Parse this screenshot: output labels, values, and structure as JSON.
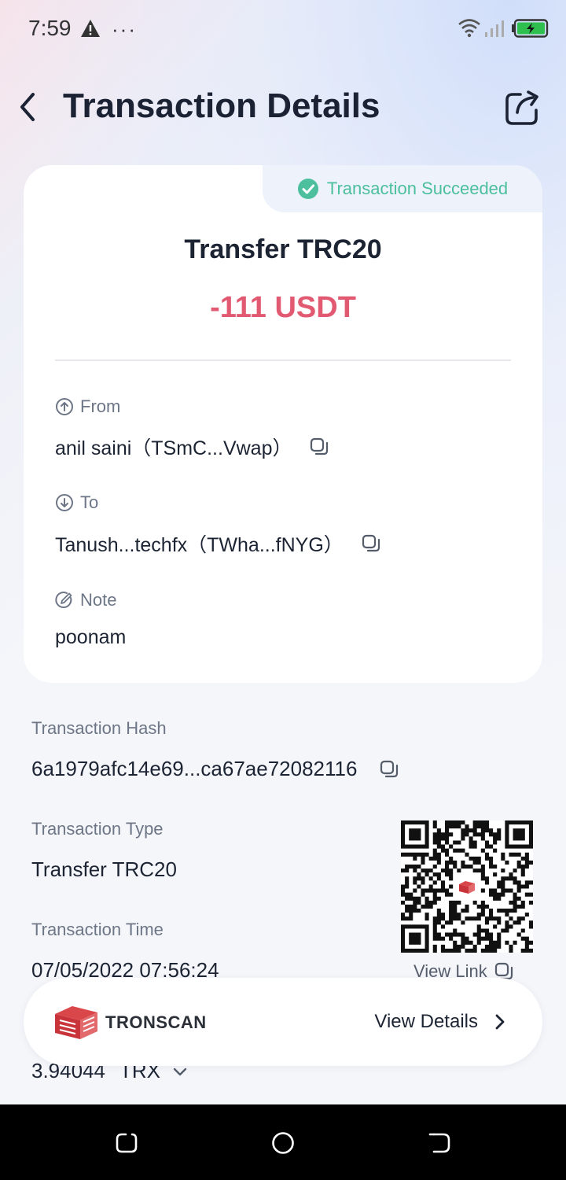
{
  "status_bar": {
    "time": "7:59",
    "more": "···"
  },
  "header": {
    "title": "Transaction Details"
  },
  "card": {
    "status": "Transaction Succeeded",
    "type": "Transfer TRC20",
    "amount": "-111 USDT",
    "from_label": "From",
    "from_value": "anil saini（TSmC...Vwap）",
    "to_label": "To",
    "to_value": "Tanush...techfx（TWha...fNYG）",
    "note_label": "Note",
    "note_value": "poonam"
  },
  "details": {
    "hash_label": "Transaction Hash",
    "hash_value": "6a1979afc14e69...ca67ae72082116",
    "type_label": "Transaction Type",
    "type_value": "Transfer TRC20",
    "time_label": "Transaction Time",
    "time_value": "07/05/2022 07:56:24",
    "view_link": "View Link",
    "fee_value": "3.94044",
    "fee_unit": "TRX"
  },
  "tronscan": {
    "name": "TRONSCAN",
    "link": "View Details"
  },
  "colors": {
    "success": "#4cbf9c",
    "amount": "#e15a72",
    "brand": "#c8343a"
  }
}
